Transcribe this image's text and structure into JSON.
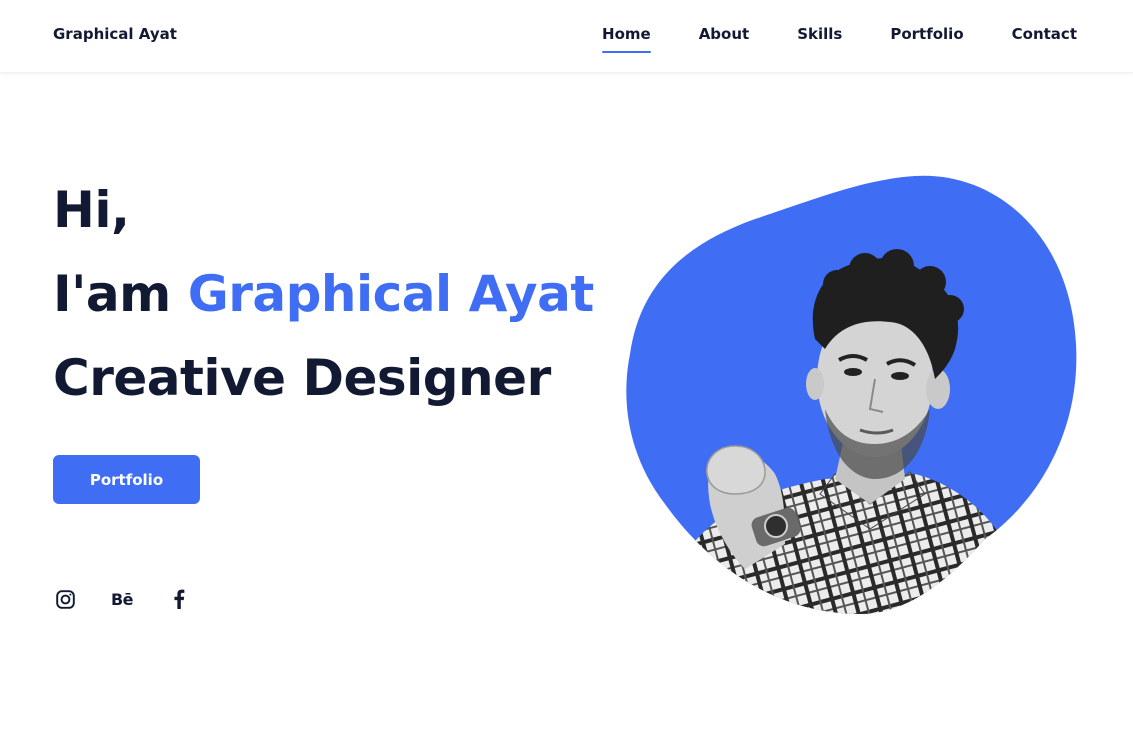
{
  "brand": {
    "name": "Graphical Ayat"
  },
  "nav": {
    "items": [
      {
        "label": "Home",
        "active": true
      },
      {
        "label": "About",
        "active": false
      },
      {
        "label": "Skills",
        "active": false
      },
      {
        "label": "Portfolio",
        "active": false
      },
      {
        "label": "Contact",
        "active": false
      }
    ]
  },
  "hero": {
    "greeting": "Hi,",
    "intro_prefix": "I'am",
    "name": "Graphical Ayat",
    "role": "Creative Designer",
    "cta_label": "Portfolio"
  },
  "socials": {
    "items": [
      {
        "icon": "instagram-icon"
      },
      {
        "icon": "behance-icon",
        "text": "Bē"
      },
      {
        "icon": "facebook-icon"
      }
    ]
  },
  "colors": {
    "accent": "#3f6ef5",
    "text": "#121a33",
    "background": "#ffffff"
  }
}
